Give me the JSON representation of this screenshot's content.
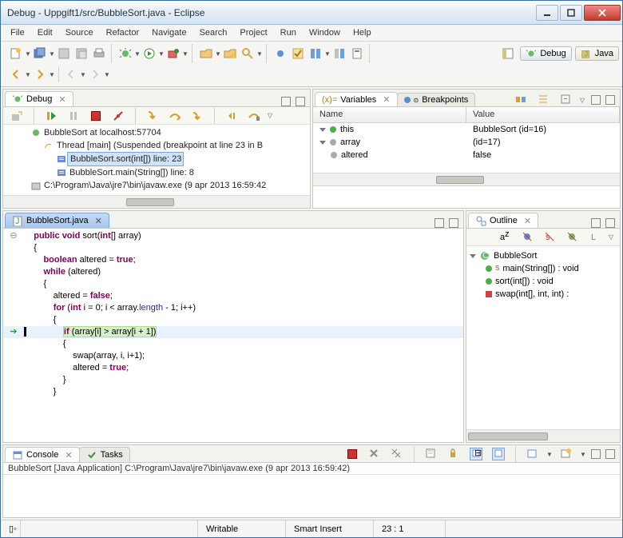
{
  "window": {
    "title": "Debug - Uppgift1/src/BubbleSort.java - Eclipse"
  },
  "menu": [
    "File",
    "Edit",
    "Source",
    "Refactor",
    "Navigate",
    "Search",
    "Project",
    "Run",
    "Window",
    "Help"
  ],
  "perspectives": {
    "debug": "Debug",
    "java": "Java"
  },
  "debug": {
    "tab": "Debug",
    "items": {
      "app": "BubbleSort at localhost:57704",
      "thread": "Thread [main] (Suspended (breakpoint at line 23 in B",
      "frame1": "BubbleSort.sort(int[]) line: 23",
      "frame2": "BubbleSort.main(String[]) line: 8",
      "process": "C:\\Program\\Java\\jre7\\bin\\javaw.exe (9 apr 2013 16:59:42"
    }
  },
  "variables": {
    "tab1": "Variables",
    "tab2": "Breakpoints",
    "colName": "Name",
    "colValue": "Value",
    "rows": [
      {
        "name": "this",
        "value": "BubbleSort  (id=16)"
      },
      {
        "name": "array",
        "value": "(id=17)"
      },
      {
        "name": "altered",
        "value": "false"
      }
    ]
  },
  "code": {
    "tab": "BubbleSort.java",
    "lines": [
      "    public void sort(int[] array)",
      "    {",
      "        boolean altered = true;",
      "        while (altered)",
      "        {",
      "            altered = false;",
      "            for (int i = 0; i < array.length - 1; i++)",
      "            {",
      "                if (array[i] > array[i + 1])",
      "                {",
      "                    swap(array, i, i+1);",
      "                    altered = true;",
      "                }",
      "            }"
    ]
  },
  "outline": {
    "tab": "Outline",
    "class": "BubbleSort",
    "members": [
      {
        "icon": "s",
        "name": "main(String[]) : void"
      },
      {
        "icon": "pub",
        "name": "sort(int[]) : void"
      },
      {
        "icon": "priv",
        "name": "swap(int[], int, int) :"
      }
    ]
  },
  "console": {
    "tab1": "Console",
    "tab2": "Tasks",
    "line": "BubbleSort [Java Application] C:\\Program\\Java\\jre7\\bin\\javaw.exe (9 apr 2013 16:59:42)"
  },
  "status": {
    "mode": "Writable",
    "insert": "Smart Insert",
    "pos": "23 : 1"
  }
}
